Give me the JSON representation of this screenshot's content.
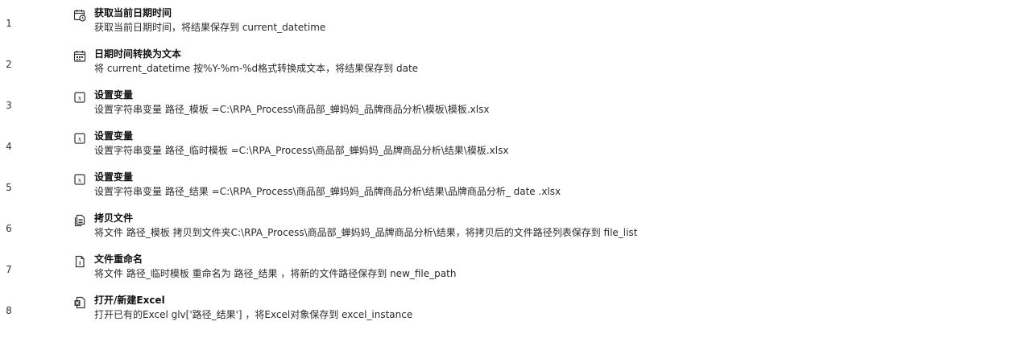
{
  "steps": [
    {
      "no": "1",
      "icon": "calendar-clock-icon",
      "title": "获取当前日期时间",
      "desc": "获取当前日期时间，将结果保存到  current_datetime"
    },
    {
      "no": "2",
      "icon": "calendar-text-icon",
      "title": "日期时间转换为文本",
      "desc": "将  current_datetime  按%Y-%m-%d格式转换成文本，将结果保存到  date"
    },
    {
      "no": "3",
      "icon": "variable-icon",
      "title": "设置变量",
      "desc": "设置字符串变量  路径_模板  =C:\\RPA_Process\\商品部_蝉妈妈_品牌商品分析\\模板\\模板.xlsx"
    },
    {
      "no": "4",
      "icon": "variable-icon",
      "title": "设置变量",
      "desc": "设置字符串变量  路径_临时模板  =C:\\RPA_Process\\商品部_蝉妈妈_品牌商品分析\\结果\\模板.xlsx"
    },
    {
      "no": "5",
      "icon": "variable-icon",
      "title": "设置变量",
      "desc": "设置字符串变量  路径_结果  =C:\\RPA_Process\\商品部_蝉妈妈_品牌商品分析\\结果\\品牌商品分析_  date  .xlsx"
    },
    {
      "no": "6",
      "icon": "copy-file-icon",
      "title": "拷贝文件",
      "desc": "将文件  路径_模板  拷贝到文件夹C:\\RPA_Process\\商品部_蝉妈妈_品牌商品分析\\结果，将拷贝后的文件路径列表保存到  file_list"
    },
    {
      "no": "7",
      "icon": "rename-file-icon",
      "title": "文件重命名",
      "desc": "将文件  路径_临时模板  重命名为  路径_结果  ，将新的文件路径保存到  new_file_path"
    },
    {
      "no": "8",
      "icon": "excel-icon",
      "title": "打开/新建Excel",
      "desc": "打开已有的Excel   glv['路径_结果']  ，将Excel对象保存到  excel_instance"
    }
  ]
}
